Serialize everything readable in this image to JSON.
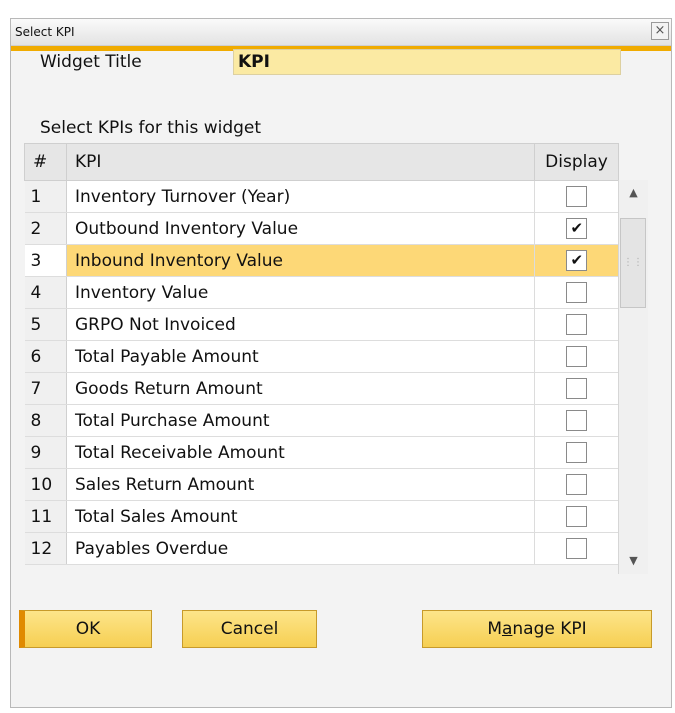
{
  "window": {
    "title": "Select KPI",
    "close_glyph": "×"
  },
  "form": {
    "widget_title_label": "Widget Title",
    "widget_title_value": "KPI",
    "section_label": "Select KPIs for this widget"
  },
  "grid": {
    "headers": {
      "num": "#",
      "kpi": "KPI",
      "display": "Display"
    },
    "selected_row": 3,
    "rows": [
      {
        "num": "1",
        "kpi": "Inventory Turnover (Year)",
        "display": false
      },
      {
        "num": "2",
        "kpi": "Outbound Inventory Value",
        "display": true
      },
      {
        "num": "3",
        "kpi": "Inbound Inventory Value",
        "display": true
      },
      {
        "num": "4",
        "kpi": "Inventory Value",
        "display": false
      },
      {
        "num": "5",
        "kpi": "GRPO Not Invoiced",
        "display": false
      },
      {
        "num": "6",
        "kpi": "Total Payable Amount",
        "display": false
      },
      {
        "num": "7",
        "kpi": "Goods Return Amount",
        "display": false
      },
      {
        "num": "8",
        "kpi": "Total Purchase Amount",
        "display": false
      },
      {
        "num": "9",
        "kpi": "Total Receivable Amount",
        "display": false
      },
      {
        "num": "10",
        "kpi": "Sales Return Amount",
        "display": false
      },
      {
        "num": "11",
        "kpi": "Total Sales Amount",
        "display": false
      },
      {
        "num": "12",
        "kpi": "Payables Overdue",
        "display": false
      }
    ]
  },
  "buttons": {
    "ok": "OK",
    "cancel": "Cancel",
    "manage_pre": "M",
    "manage_mnemonic": "a",
    "manage_post": "nage KPI"
  },
  "colors": {
    "accent": "#f0ab00",
    "selected_row": "#fdd877",
    "input_bg": "#fbeaa3",
    "button_bg": "#f6cf52"
  }
}
